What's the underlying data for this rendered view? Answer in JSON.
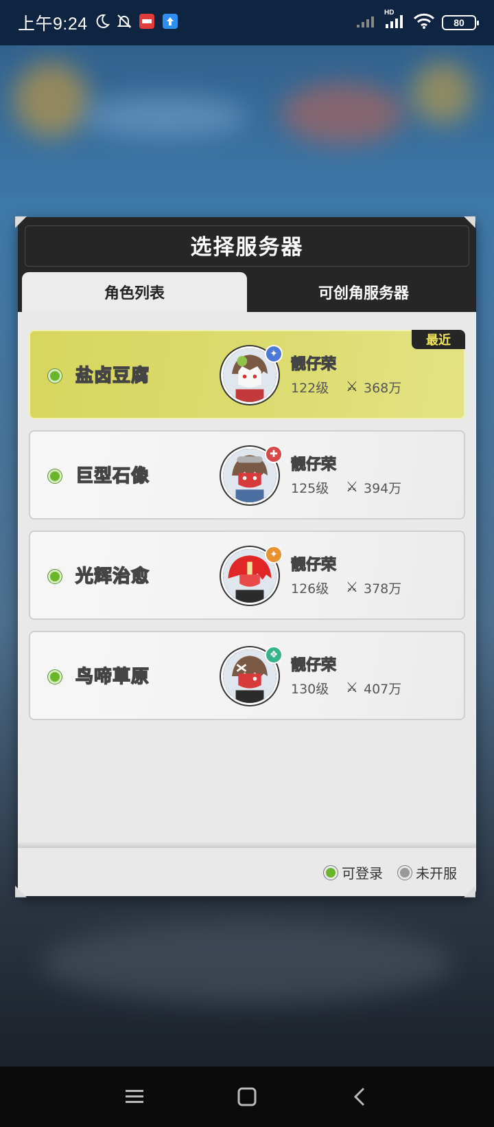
{
  "status_bar": {
    "time": "上午9:24",
    "battery": "80",
    "signal_label": "HD"
  },
  "dialog": {
    "title": "选择服务器",
    "tabs": [
      {
        "label": "角色列表",
        "active": true
      },
      {
        "label": "可创角服务器",
        "active": false
      }
    ],
    "recent_tag": "最近",
    "servers": [
      {
        "name": "盐卤豆腐",
        "character": "靓仔荣",
        "level": "122级",
        "power": "368万",
        "recent": true,
        "badge_color": "#4c78d8"
      },
      {
        "name": "巨型石像",
        "character": "靓仔荣",
        "level": "125级",
        "power": "394万",
        "recent": false,
        "badge_color": "#d64a4a"
      },
      {
        "name": "光辉治愈",
        "character": "靓仔荣",
        "level": "126级",
        "power": "378万",
        "recent": false,
        "badge_color": "#e7922e"
      },
      {
        "name": "鸟啼草原",
        "character": "靓仔荣",
        "level": "130级",
        "power": "407万",
        "recent": false,
        "badge_color": "#35b48c"
      }
    ],
    "legend": {
      "available": "可登录",
      "unopened": "未开服",
      "available_color": "#6bb52a",
      "unopened_color": "#9a9a9a"
    }
  }
}
